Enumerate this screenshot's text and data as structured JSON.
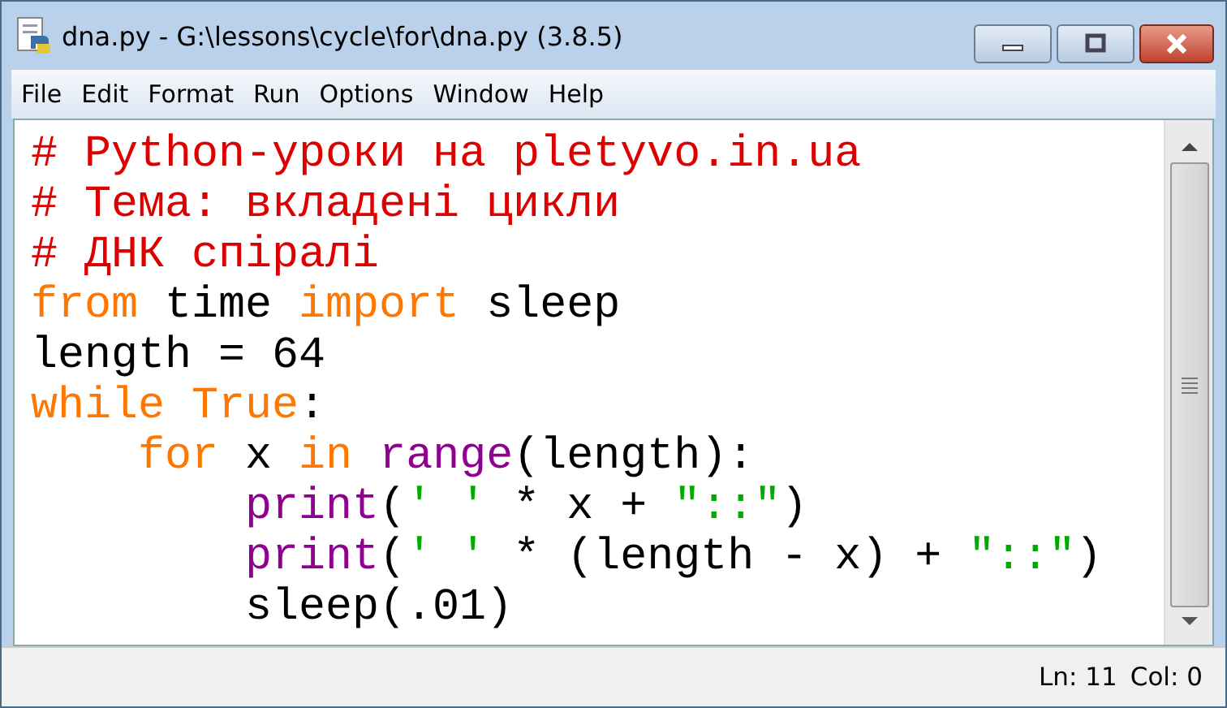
{
  "window": {
    "title": "dna.py - G:\\lessons\\cycle\\for\\dna.py (3.8.5)"
  },
  "menu": [
    "File",
    "Edit",
    "Format",
    "Run",
    "Options",
    "Window",
    "Help"
  ],
  "code": [
    [
      {
        "kind": "comment",
        "text": "# Python-уроки на pletyvo.in.ua"
      }
    ],
    [
      {
        "kind": "comment",
        "text": "# Тема: вкладені цикли"
      }
    ],
    [
      {
        "kind": "comment",
        "text": "# ДНК спіралі"
      }
    ],
    [
      {
        "kind": "keyword",
        "text": "from"
      },
      {
        "kind": "plain",
        "text": " time "
      },
      {
        "kind": "keyword",
        "text": "import"
      },
      {
        "kind": "plain",
        "text": " sleep"
      }
    ],
    [
      {
        "kind": "plain",
        "text": "length = 64"
      }
    ],
    [
      {
        "kind": "keyword",
        "text": "while True"
      },
      {
        "kind": "plain",
        "text": ":"
      }
    ],
    [
      {
        "kind": "keyword",
        "text": "    for"
      },
      {
        "kind": "plain",
        "text": " x "
      },
      {
        "kind": "keyword",
        "text": "in"
      },
      {
        "kind": "builtin",
        "text": " range"
      },
      {
        "kind": "plain",
        "text": "(length):"
      }
    ],
    [
      {
        "kind": "builtin",
        "text": "        print"
      },
      {
        "kind": "plain",
        "text": "("
      },
      {
        "kind": "string",
        "text": "' '"
      },
      {
        "kind": "plain",
        "text": " * x + "
      },
      {
        "kind": "string",
        "text": "\"::\""
      },
      {
        "kind": "plain",
        "text": ")"
      }
    ],
    [
      {
        "kind": "builtin",
        "text": "        print"
      },
      {
        "kind": "plain",
        "text": "("
      },
      {
        "kind": "string",
        "text": "' '"
      },
      {
        "kind": "plain",
        "text": " * (length - x) + "
      },
      {
        "kind": "string",
        "text": "\"::\""
      },
      {
        "kind": "plain",
        "text": ")"
      }
    ],
    [
      {
        "kind": "plain",
        "text": "        sleep(.01)"
      }
    ]
  ],
  "status": {
    "line": "Ln: 11",
    "col": "Col: 0"
  }
}
